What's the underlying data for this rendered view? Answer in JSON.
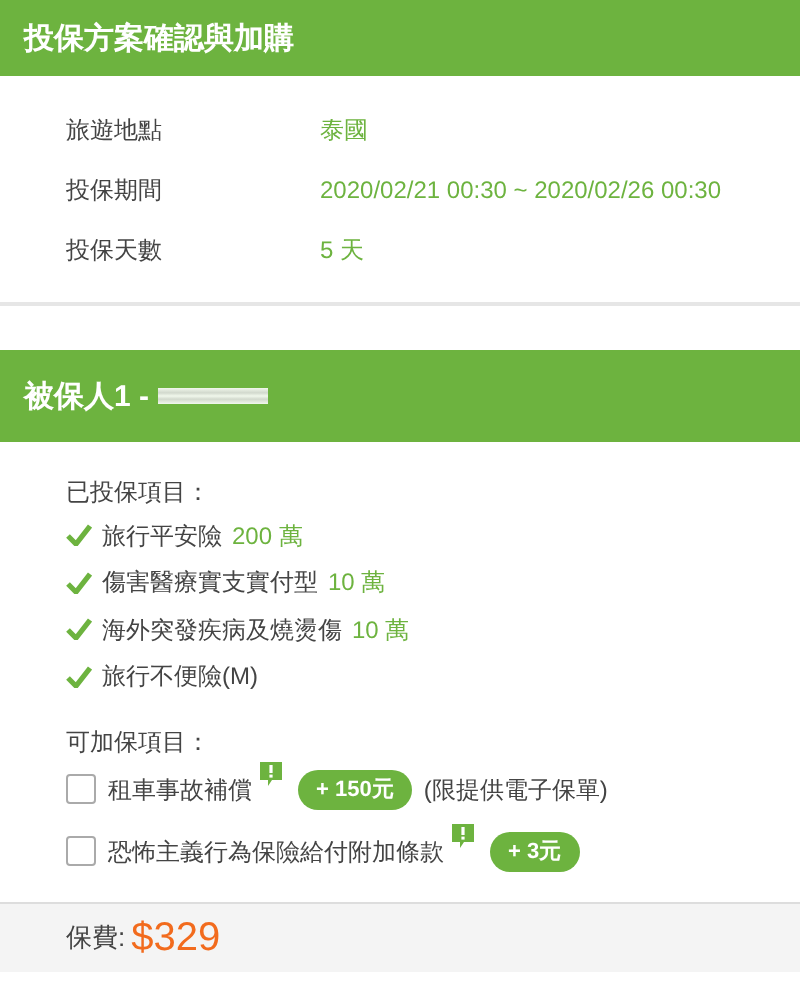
{
  "plan": {
    "title": "投保方案確認與加購",
    "rows": [
      {
        "label": "旅遊地點",
        "value": "泰國"
      },
      {
        "label": "投保期間",
        "value": "2020/02/21 00:30 ~ 2020/02/26 00:30"
      },
      {
        "label": "投保天數",
        "value": "5 天"
      }
    ]
  },
  "insured": {
    "title": "被保人1 -",
    "covered_heading": "已投保項目：",
    "covered": [
      {
        "name": "旅行平安險",
        "amount": "200 萬"
      },
      {
        "name": "傷害醫療實支實付型",
        "amount": "10 萬"
      },
      {
        "name": "海外突發疾病及燒燙傷",
        "amount": "10 萬"
      },
      {
        "name": "旅行不便險(M)"
      }
    ],
    "addon_heading": "可加保項目：",
    "addons": [
      {
        "name": "租車事故補償",
        "checked": false,
        "price": "+ 150元",
        "note": "(限提供電子保單)"
      },
      {
        "name": "恐怖主義行為保險給付附加條款",
        "checked": false,
        "price": "+ 3元"
      }
    ]
  },
  "footer": {
    "label": "保費:",
    "price": "$329"
  }
}
